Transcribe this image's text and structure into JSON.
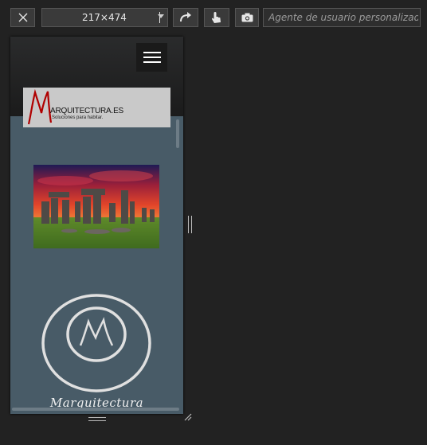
{
  "toolbar": {
    "size_value": "217×474",
    "user_agent_placeholder": "Agente de usuario personalizado"
  },
  "icons": {
    "close": "close-icon",
    "dropdown": "chevron-down-icon",
    "rotate": "rotate-icon",
    "touch": "touch-icon",
    "screenshot": "camera-icon",
    "menu": "hamburger-icon"
  },
  "site": {
    "logo_title": "ARQUITECTURA.ES",
    "logo_tagline": "Soluciones para habitar.",
    "brand_name": "Marquitectura"
  },
  "colors": {
    "page_background": "#485b67",
    "logo_red": "#b00000",
    "toolbar_background": "#222222"
  }
}
